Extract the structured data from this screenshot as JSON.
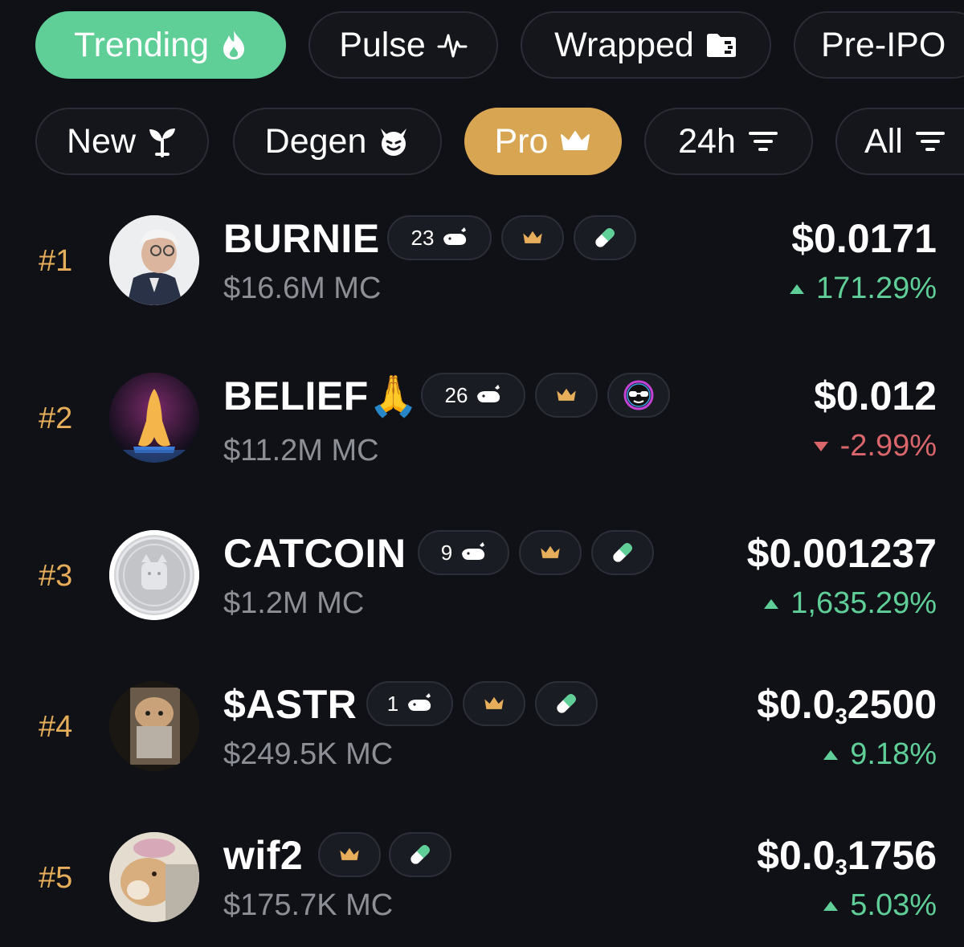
{
  "top_tabs": [
    {
      "label": "Trending",
      "icon": "flame-icon",
      "active": true
    },
    {
      "label": "Pulse",
      "icon": "pulse-icon",
      "active": false
    },
    {
      "label": "Wrapped",
      "icon": "folder-icon",
      "active": false
    },
    {
      "label": "Pre-IPO",
      "icon": "",
      "active": false
    }
  ],
  "filters": [
    {
      "label": "New",
      "icon": "sprout-icon",
      "active": false
    },
    {
      "label": "Degen",
      "icon": "devil-icon",
      "active": false
    },
    {
      "label": "Pro",
      "icon": "crown-icon",
      "active": true
    },
    {
      "label": "24h",
      "icon": "sort-icon",
      "active": false
    },
    {
      "label": "All",
      "icon": "sort-icon",
      "active": false
    }
  ],
  "tokens": [
    {
      "rank": "#1",
      "name": "BURNIE",
      "mc": "$16.6M MC",
      "whales": "23",
      "price_main": "$0.0171",
      "price_sub": "",
      "price_tail": "",
      "change": "171.29%",
      "direction": "up",
      "badges": [
        "whale",
        "crown",
        "pill"
      ]
    },
    {
      "rank": "#2",
      "name": "BELIEF🙏",
      "mc": "$11.2M MC",
      "whales": "26",
      "price_main": "$0.012",
      "price_sub": "",
      "price_tail": "",
      "change": "-2.99%",
      "direction": "down",
      "badges": [
        "whale",
        "crown",
        "goggles"
      ]
    },
    {
      "rank": "#3",
      "name": "CATCOIN",
      "mc": "$1.2M MC",
      "whales": "9",
      "price_main": "$0.001237",
      "price_sub": "",
      "price_tail": "",
      "change": "1,635.29%",
      "direction": "up",
      "badges": [
        "whale",
        "crown",
        "pill"
      ]
    },
    {
      "rank": "#4",
      "name": "$ASTR",
      "mc": "$249.5K MC",
      "whales": "1",
      "price_main": "$0.0",
      "price_sub": "3",
      "price_tail": "2500",
      "change": "9.18%",
      "direction": "up",
      "badges": [
        "whale",
        "crown",
        "pill"
      ]
    },
    {
      "rank": "#5",
      "name": "wif2",
      "mc": "$175.7K MC",
      "whales": "",
      "price_main": "$0.0",
      "price_sub": "3",
      "price_tail": "1756",
      "change": "5.03%",
      "direction": "up",
      "badges": [
        "crown",
        "pill"
      ]
    }
  ],
  "colors": {
    "green": "#5fcf97",
    "gold": "#d8a652",
    "red": "#d9666b",
    "rank": "#e6ae5a",
    "bg": "#101116"
  }
}
